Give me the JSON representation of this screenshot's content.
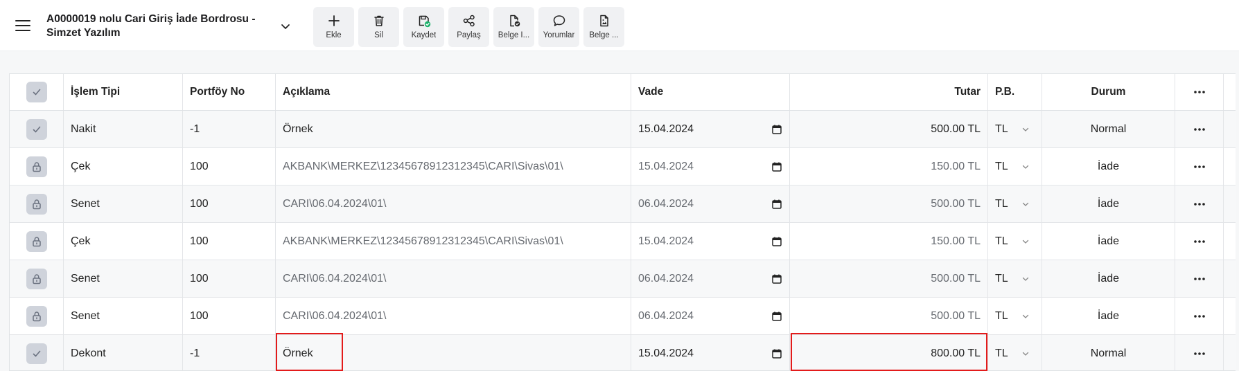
{
  "header": {
    "title": "A0000019 nolu Cari Giriş İade Bordrosu - Simzet Yazılım",
    "toolbar": [
      {
        "label": "Ekle",
        "icon": "plus-icon"
      },
      {
        "label": "Sil",
        "icon": "trash-icon"
      },
      {
        "label": "Kaydet",
        "icon": "save-check-icon"
      },
      {
        "label": "Paylaş",
        "icon": "share-icon"
      },
      {
        "label": "Belge İ...",
        "icon": "document-check-icon"
      },
      {
        "label": "Yorumlar",
        "icon": "comment-icon"
      },
      {
        "label": "Belge ...",
        "icon": "document-image-icon"
      }
    ]
  },
  "table": {
    "columns": {
      "type": "İşlem Tipi",
      "portfolio": "Portföy No",
      "description": "Açıklama",
      "due": "Vade",
      "amount": "Tutar",
      "currency": "P.B.",
      "status": "Durum",
      "more": "···"
    },
    "rows": [
      {
        "type": "Nakit",
        "portfolio": "-1",
        "description": "Örnek",
        "due": "15.04.2024",
        "amount": "500.00 TL",
        "currency": "TL",
        "status": "Normal",
        "locked": false
      },
      {
        "type": "Çek",
        "portfolio": "100",
        "description": "AKBANK\\MERKEZ\\12345678912312345\\CARI\\Sivas\\01\\",
        "due": "15.04.2024",
        "amount": "150.00 TL",
        "currency": "TL",
        "status": "İade",
        "locked": true
      },
      {
        "type": "Senet",
        "portfolio": "100",
        "description": "CARI\\06.04.2024\\01\\",
        "due": "06.04.2024",
        "amount": "500.00 TL",
        "currency": "TL",
        "status": "İade",
        "locked": true
      },
      {
        "type": "Çek",
        "portfolio": "100",
        "description": "AKBANK\\MERKEZ\\12345678912312345\\CARI\\Sivas\\01\\",
        "due": "15.04.2024",
        "amount": "150.00 TL",
        "currency": "TL",
        "status": "İade",
        "locked": true
      },
      {
        "type": "Senet",
        "portfolio": "100",
        "description": "CARI\\06.04.2024\\01\\",
        "due": "06.04.2024",
        "amount": "500.00 TL",
        "currency": "TL",
        "status": "İade",
        "locked": true
      },
      {
        "type": "Senet",
        "portfolio": "100",
        "description": "CARI\\06.04.2024\\01\\",
        "due": "06.04.2024",
        "amount": "500.00 TL",
        "currency": "TL",
        "status": "İade",
        "locked": true
      },
      {
        "type": "Dekont",
        "portfolio": "-1",
        "description": "Örnek",
        "due": "15.04.2024",
        "amount": "800.00 TL",
        "currency": "TL",
        "status": "Normal",
        "locked": false
      }
    ]
  },
  "colors": {
    "highlight": "#e31b1b",
    "check_bg": "#cfd3db",
    "save_badge": "#1bb26b"
  }
}
